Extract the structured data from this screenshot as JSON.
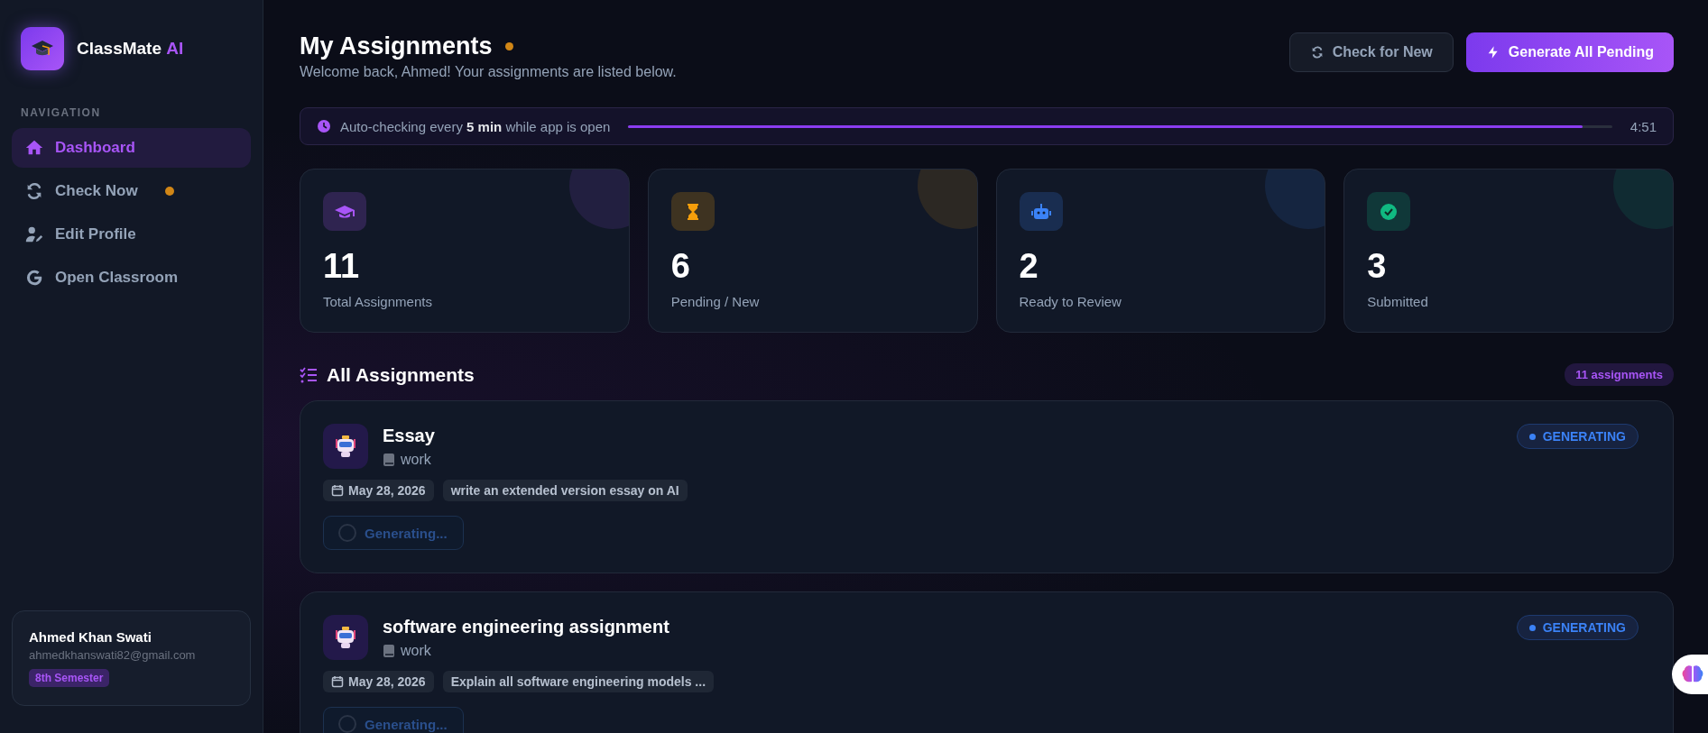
{
  "brand": {
    "name": "ClassMate",
    "accent": "AI"
  },
  "sidebar": {
    "section_label": "NAVIGATION",
    "items": [
      {
        "label": "Dashboard",
        "selected": true,
        "badge": false
      },
      {
        "label": "Check Now",
        "selected": false,
        "badge": true
      },
      {
        "label": "Edit Profile",
        "selected": false,
        "badge": false
      },
      {
        "label": "Open Classroom",
        "selected": false,
        "badge": false
      }
    ],
    "profile": {
      "name": "Ahmed Khan Swati",
      "email": "ahmedkhanswati82@gmail.com",
      "tag": "8th Semester"
    }
  },
  "header": {
    "title": "My Assignments",
    "subtitle": "Welcome back, Ahmed! Your assignments are listed below.",
    "buttons": [
      {
        "label": "Check for New",
        "kind": "secondary"
      },
      {
        "label": "Generate All Pending",
        "kind": "primary"
      }
    ]
  },
  "auto_check": {
    "text": "Auto-checking every **5 min** while app is open",
    "level": 0.97,
    "countdown": "4:51"
  },
  "stats": [
    {
      "value": "11",
      "label": "Total Assignments",
      "color": "#a855f7"
    },
    {
      "value": "6",
      "label": "Pending / New",
      "color": "#f59e0b"
    },
    {
      "value": "2",
      "label": "Ready to Review",
      "color": "#3b82f6"
    },
    {
      "value": "3",
      "label": "Submitted",
      "color": "#10b981"
    }
  ],
  "assignments_section": {
    "title": "All Assignments",
    "count": "11 assignments",
    "items": [
      {
        "title": "Essay",
        "subject": "work",
        "date": "May 28, 2026",
        "description": "write an extended version essay on AI",
        "status": "GENERATING",
        "action": "Generating...",
        "disabled": true
      },
      {
        "title": "software engineering assignment",
        "subject": "work",
        "date": "May 28, 2026",
        "description": "Explain all software engineering models ...",
        "status": "GENERATING",
        "action": "Generating...",
        "disabled": true
      }
    ]
  }
}
